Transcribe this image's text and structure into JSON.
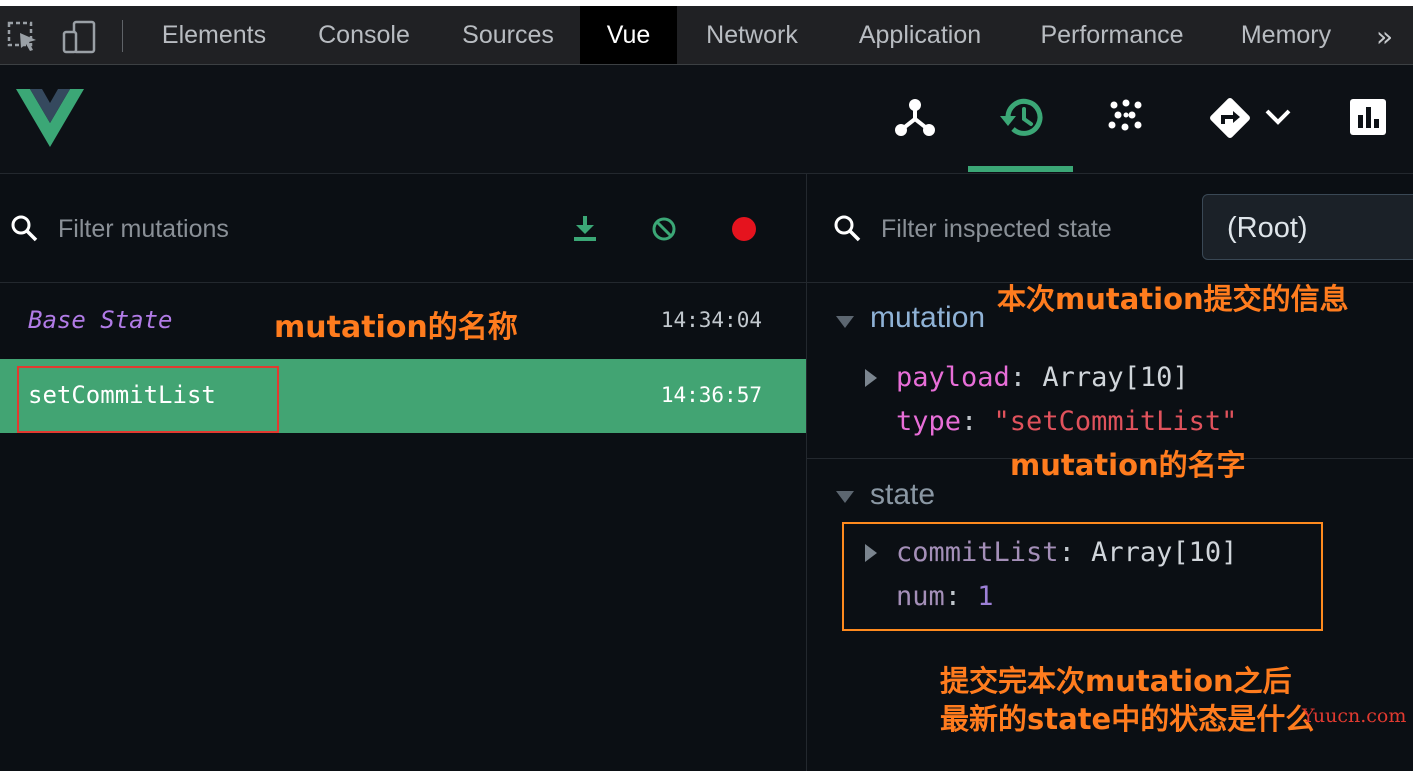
{
  "devtools": {
    "tabs": [
      "Elements",
      "Console",
      "Sources",
      "Vue",
      "Network",
      "Application",
      "Performance",
      "Memory"
    ],
    "active_tab": "Vue",
    "more_label": "»",
    "tool_icons": [
      "inspect-element-icon",
      "device-toolbar-icon"
    ]
  },
  "vue_header": {
    "logo": "vue-logo",
    "icons": [
      "components-icon",
      "history-icon",
      "vuex-icon",
      "routing-icon",
      "dropdown-chevron-icon",
      "performance-icon"
    ],
    "active_icon": "history-icon",
    "accent_color": "#3ba776"
  },
  "left": {
    "filter_placeholder": "Filter mutations",
    "actions": [
      "download-icon",
      "clear-icon",
      "record-icon"
    ],
    "record_color": "#e5131e",
    "mutations": [
      {
        "name": "Base State",
        "time": "14:34:04",
        "selected": false
      },
      {
        "name": "setCommitList",
        "time": "14:36:57",
        "selected": true
      }
    ]
  },
  "right": {
    "filter_placeholder": "Filter inspected state",
    "root_select": "(Root)",
    "mutation_section": {
      "title": "mutation",
      "payload_key": "payload",
      "payload_value": "Array[10]",
      "type_key": "type",
      "type_value": "\"setCommitList\""
    },
    "state_section": {
      "title": "state",
      "commitlist_key": "commitList",
      "commitlist_value": "Array[10]",
      "num_key": "num",
      "num_value": "1"
    }
  },
  "annotations": {
    "mutation_name": "mutation的名称",
    "commit_info": "本次mutation提交的信息",
    "mutation_type_name": "mutation的名字",
    "after_line1": "提交完本次mutation之后",
    "after_line2": "最新的state中的状态是什么",
    "watermark": "Yuucn.com",
    "color": "#ff7c1e"
  }
}
